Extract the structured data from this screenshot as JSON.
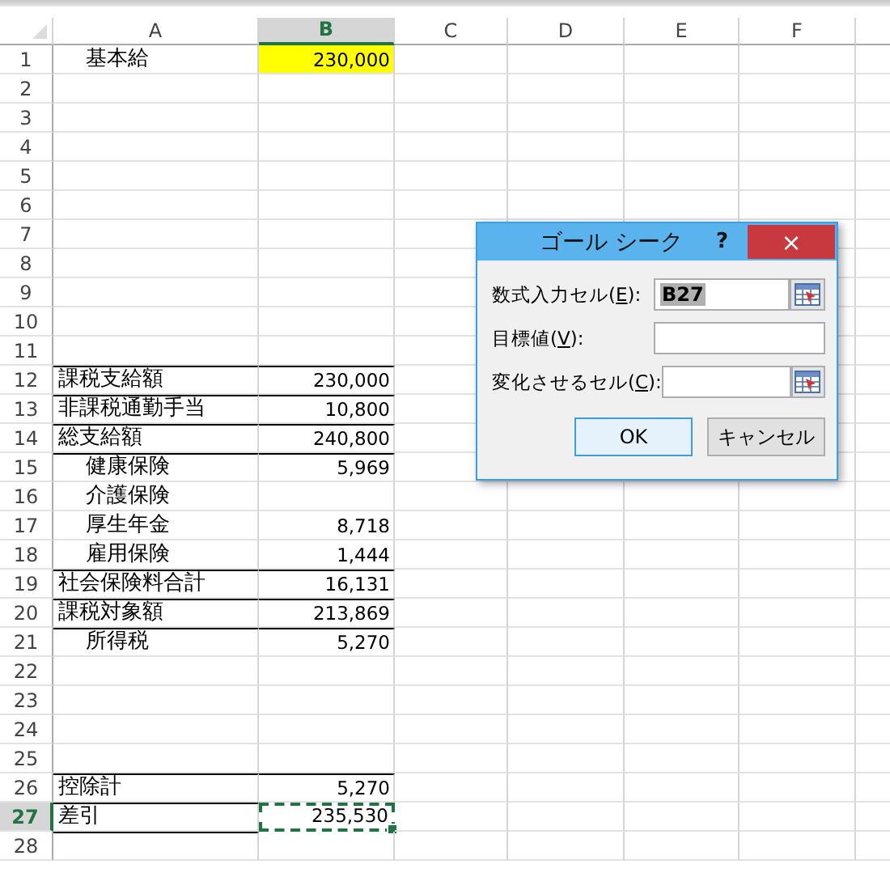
{
  "columns": [
    {
      "label": "A",
      "selected": false
    },
    {
      "label": "B",
      "selected": true
    },
    {
      "label": "C",
      "selected": false
    },
    {
      "label": "D",
      "selected": false
    },
    {
      "label": "E",
      "selected": false
    },
    {
      "label": "F",
      "selected": false
    }
  ],
  "rows": [
    {
      "number": "1",
      "label": "基本給",
      "value": "230,000",
      "indent": true,
      "highlighted": true,
      "rule_above": false,
      "selected": false
    },
    {
      "number": "2",
      "rule_above": false,
      "selected": false
    },
    {
      "number": "3",
      "rule_above": false,
      "selected": false
    },
    {
      "number": "4",
      "rule_above": false,
      "selected": false
    },
    {
      "number": "5",
      "rule_above": false,
      "selected": false
    },
    {
      "number": "6",
      "rule_above": false,
      "selected": false
    },
    {
      "number": "7",
      "rule_above": false,
      "selected": false
    },
    {
      "number": "8",
      "rule_above": false,
      "selected": false
    },
    {
      "number": "9",
      "rule_above": false,
      "selected": false
    },
    {
      "number": "10",
      "rule_above": false,
      "selected": false
    },
    {
      "number": "11",
      "rule_above": false,
      "selected": false
    },
    {
      "number": "12",
      "label": "課税支給額",
      "value": "230,000",
      "indent": false,
      "rule_above": true,
      "selected": false
    },
    {
      "number": "13",
      "label": "非課税通勤手当",
      "value": "10,800",
      "indent": false,
      "rule_above": true,
      "selected": false
    },
    {
      "number": "14",
      "label": "総支給額",
      "value": "240,800",
      "indent": false,
      "rule_above": true,
      "selected": false
    },
    {
      "number": "15",
      "label": "健康保険",
      "value": "5,969",
      "indent": true,
      "rule_above": true,
      "selected": false
    },
    {
      "number": "16",
      "label": "介護保険",
      "indent": true,
      "rule_above": false,
      "selected": false
    },
    {
      "number": "17",
      "label": "厚生年金",
      "value": "8,718",
      "indent": true,
      "rule_above": false,
      "selected": false
    },
    {
      "number": "18",
      "label": "雇用保険",
      "value": "1,444",
      "indent": true,
      "rule_above": false,
      "selected": false
    },
    {
      "number": "19",
      "label": "社会保険料合計",
      "value": "16,131",
      "indent": false,
      "rule_above": true,
      "selected": false
    },
    {
      "number": "20",
      "label": "課税対象額",
      "value": "213,869",
      "indent": false,
      "rule_above": true,
      "selected": false
    },
    {
      "number": "21",
      "label": "所得税",
      "value": "5,270",
      "indent": true,
      "rule_above": true,
      "selected": false
    },
    {
      "number": "22",
      "rule_above": false,
      "selected": false
    },
    {
      "number": "23",
      "rule_above": false,
      "selected": false
    },
    {
      "number": "24",
      "rule_above": false,
      "selected": false
    },
    {
      "number": "25",
      "rule_above": false,
      "selected": false
    },
    {
      "number": "26",
      "label": "控除計",
      "value": "5,270",
      "indent": false,
      "rule_above": true,
      "selected": false
    },
    {
      "number": "27",
      "label": "差引",
      "value": "235,530",
      "indent": false,
      "rule_above": true,
      "selected": true,
      "marquee": true
    },
    {
      "number": "28",
      "rule_above": true,
      "selected": false
    }
  ],
  "dialog": {
    "title": "ゴール シーク",
    "help": "?",
    "close": "×",
    "fields": [
      {
        "label": "数式入力セル(**E**):",
        "value": "B27",
        "picker": true
      },
      {
        "label": "目標値(**V**):",
        "picker": false
      },
      {
        "label": "変化させるセル(**C**):",
        "picker": true
      }
    ],
    "buttons": [
      {
        "label": "OK",
        "default": true
      },
      {
        "label": "キャンセル",
        "default": false
      }
    ]
  }
}
